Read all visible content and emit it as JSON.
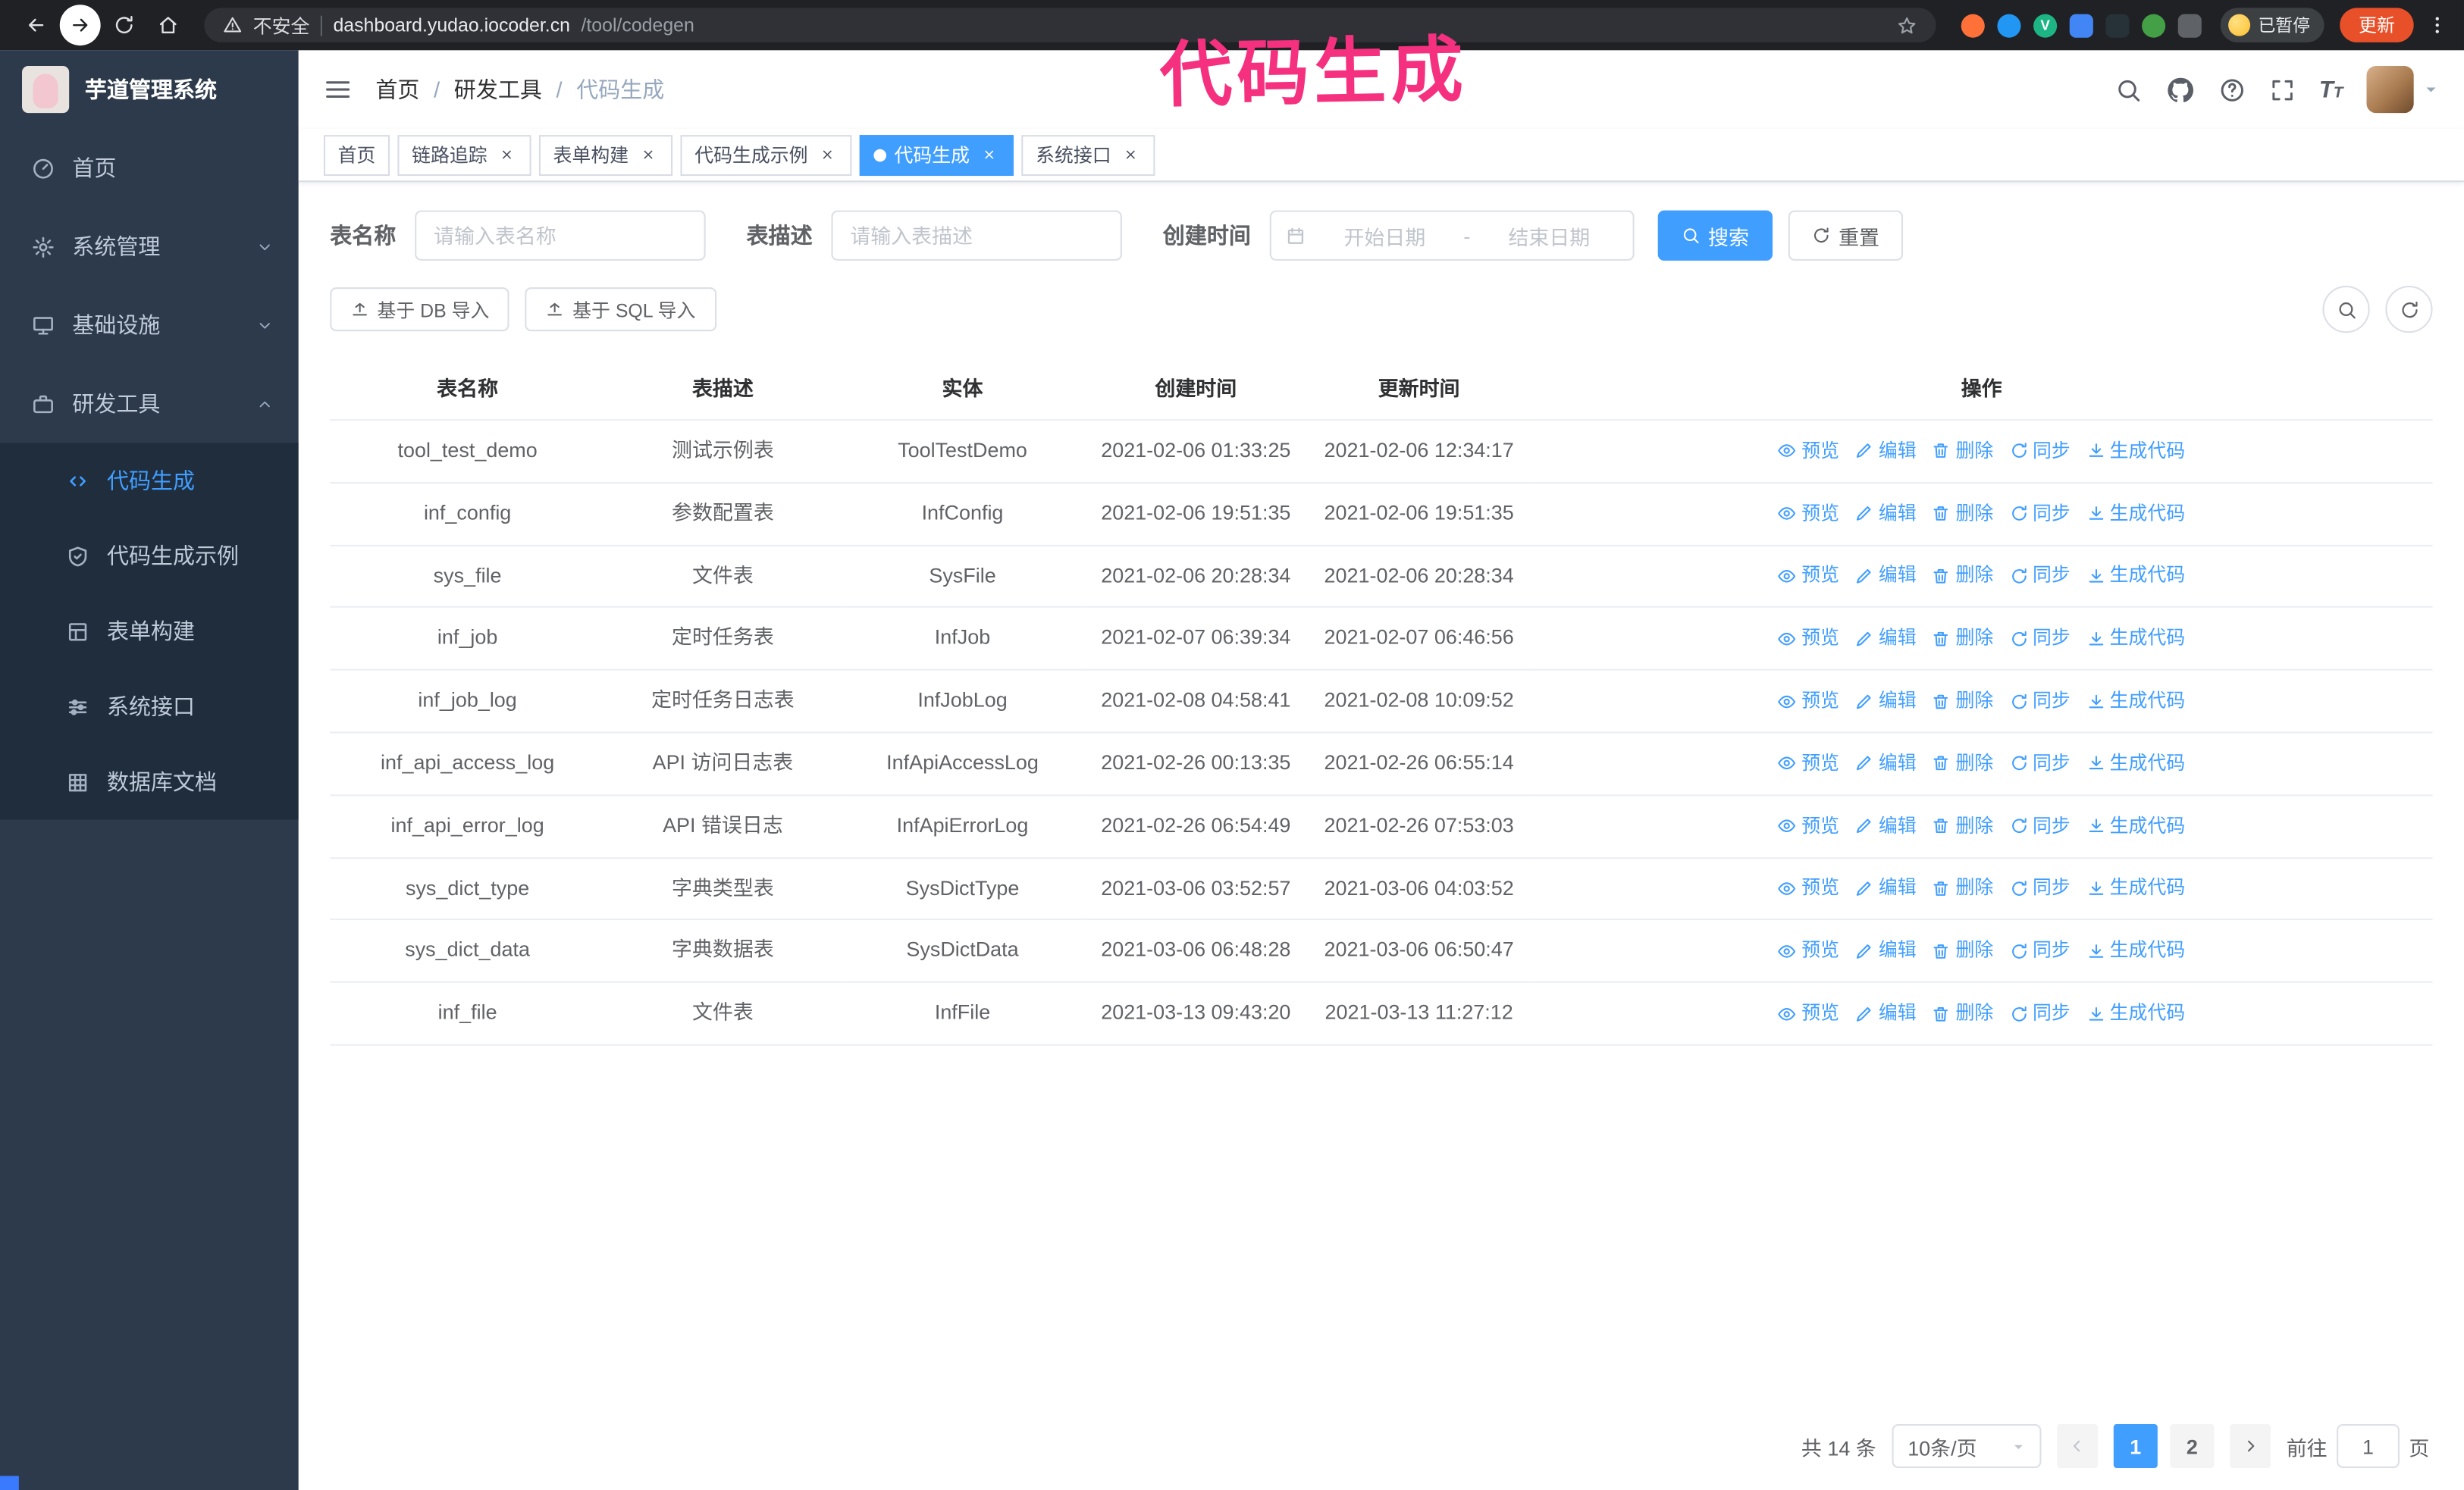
{
  "colors": {
    "primary": "#409eff",
    "annotation": "#f5317f",
    "update_button": "#e8502a",
    "active_tag": "#409eff",
    "sidebar_bg": "#2d3a4b",
    "submenu_bg": "#1f2d3d"
  },
  "annotation": {
    "text": "代码生成"
  },
  "browser": {
    "security_label": "不安全",
    "url_host": "dashboard.yudao.iocoder.cn",
    "url_path": "/tool/codegen",
    "extensions": [
      {
        "color": "#ff7139",
        "circle": true
      },
      {
        "color": "#2196f3",
        "circle": true
      },
      {
        "color": "#1db584",
        "circle": true,
        "letter": "V"
      },
      {
        "color": "#4285f4",
        "circle": false
      },
      {
        "color": "#263238",
        "circle": false
      },
      {
        "color": "#43a047",
        "circle": true
      },
      {
        "color": "#5f6368",
        "circle": false
      }
    ],
    "paused_badge": "已暂停",
    "update_button": "更新"
  },
  "sidebar": {
    "logo_title": "芋道管理系统",
    "items": [
      {
        "label": "首页",
        "icon": "dashboard-icon"
      },
      {
        "label": "系统管理",
        "icon": "gear-icon",
        "chevron": "chevron-down-icon"
      },
      {
        "label": "基础设施",
        "icon": "infra-icon",
        "chevron": "chevron-down-icon"
      },
      {
        "label": "研发工具",
        "icon": "tools-icon",
        "chevron": "chevron-up-icon"
      }
    ],
    "submenu": [
      {
        "label": "代码生成",
        "icon": "code-icon",
        "active": true
      },
      {
        "label": "代码生成示例",
        "icon": "shield-icon"
      },
      {
        "label": "表单构建",
        "icon": "form-icon"
      },
      {
        "label": "系统接口",
        "icon": "api-icon"
      },
      {
        "label": "数据库文档",
        "icon": "db-icon"
      }
    ]
  },
  "header": {
    "breadcrumb": [
      "首页",
      "研发工具",
      "代码生成"
    ],
    "separator": "/"
  },
  "tags": [
    {
      "label": "首页"
    },
    {
      "label": "链路追踪",
      "closable": true
    },
    {
      "label": "表单构建",
      "closable": true
    },
    {
      "label": "代码生成示例",
      "closable": true
    },
    {
      "label": "代码生成",
      "closable": true,
      "active": true
    },
    {
      "label": "系统接口",
      "closable": true
    }
  ],
  "filters": {
    "table_name_label": "表名称",
    "table_name_placeholder": "请输入表名称",
    "table_desc_label": "表描述",
    "table_desc_placeholder": "请输入表描述",
    "create_time_label": "创建时间",
    "date_start_placeholder": "开始日期",
    "date_separator": "-",
    "date_end_placeholder": "结束日期",
    "search_button": "搜索",
    "reset_button": "重置"
  },
  "toolbar": {
    "import_db": "基于 DB 导入",
    "import_sql": "基于 SQL 导入"
  },
  "table": {
    "columns": [
      "表名称",
      "表描述",
      "实体",
      "创建时间",
      "更新时间",
      "操作"
    ],
    "actions": [
      "预览",
      "编辑",
      "删除",
      "同步",
      "生成代码"
    ],
    "rows": [
      {
        "name": "tool_test_demo",
        "desc": "测试示例表",
        "entity": "ToolTestDemo",
        "created": "2021-02-06 01:33:25",
        "updated": "2021-02-06 12:34:17"
      },
      {
        "name": "inf_config",
        "desc": "参数配置表",
        "entity": "InfConfig",
        "created": "2021-02-06 19:51:35",
        "updated": "2021-02-06 19:51:35"
      },
      {
        "name": "sys_file",
        "desc": "文件表",
        "entity": "SysFile",
        "created": "2021-02-06 20:28:34",
        "updated": "2021-02-06 20:28:34"
      },
      {
        "name": "inf_job",
        "desc": "定时任务表",
        "entity": "InfJob",
        "created": "2021-02-07 06:39:34",
        "updated": "2021-02-07 06:46:56"
      },
      {
        "name": "inf_job_log",
        "desc": "定时任务日志表",
        "entity": "InfJobLog",
        "created": "2021-02-08 04:58:41",
        "updated": "2021-02-08 10:09:52"
      },
      {
        "name": "inf_api_access_log",
        "desc": "API 访问日志表",
        "entity": "InfApiAccessLog",
        "created": "2021-02-26 00:13:35",
        "updated": "2021-02-26 06:55:14"
      },
      {
        "name": "inf_api_error_log",
        "desc": "API 错误日志",
        "entity": "InfApiErrorLog",
        "created": "2021-02-26 06:54:49",
        "updated": "2021-02-26 07:53:03"
      },
      {
        "name": "sys_dict_type",
        "desc": "字典类型表",
        "entity": "SysDictType",
        "created": "2021-03-06 03:52:57",
        "updated": "2021-03-06 04:03:52"
      },
      {
        "name": "sys_dict_data",
        "desc": "字典数据表",
        "entity": "SysDictData",
        "created": "2021-03-06 06:48:28",
        "updated": "2021-03-06 06:50:47"
      },
      {
        "name": "inf_file",
        "desc": "文件表",
        "entity": "InfFile",
        "created": "2021-03-13 09:43:20",
        "updated": "2021-03-13 11:27:12"
      }
    ]
  },
  "pagination": {
    "total": "共 14 条",
    "page_size": "10条/页",
    "pages": [
      {
        "label": "1",
        "active": true
      },
      {
        "label": "2"
      }
    ],
    "goto_label": "前往",
    "goto_value": "1",
    "goto_suffix": "页"
  }
}
